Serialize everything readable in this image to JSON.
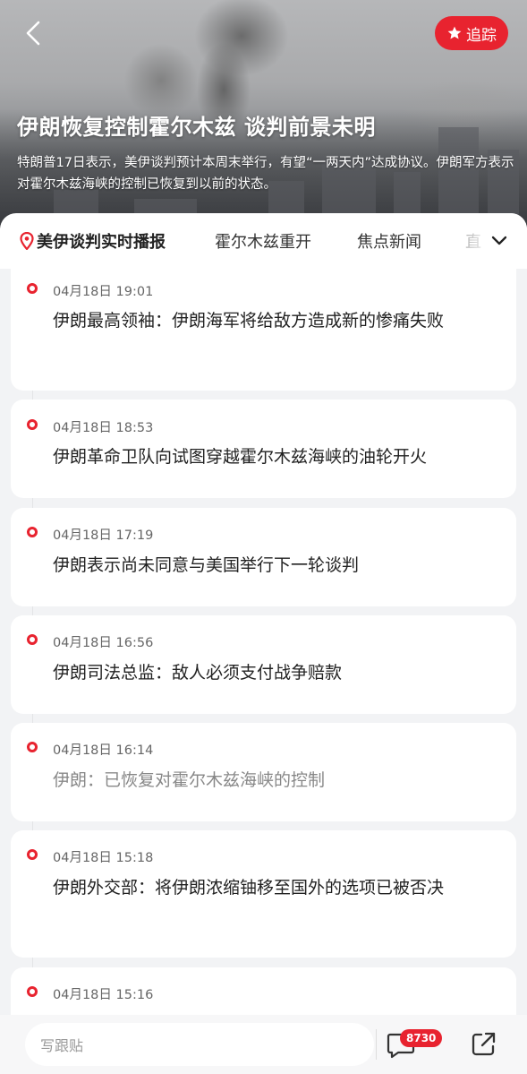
{
  "header": {
    "follow_label": "追踪",
    "title": "伊朗恢复控制霍尔木兹 谈判前景未明",
    "description": "特朗普17日表示，美伊谈判预计本周末举行，有望“一两天内”达成协议。伊朗军方表示对霍尔木兹海峡的控制已恢复到以前的状态。"
  },
  "tabs": [
    {
      "label": "美伊谈判实时播报",
      "active": true
    },
    {
      "label": "霍尔木兹重开",
      "active": false
    },
    {
      "label": "焦点新闻",
      "active": false
    },
    {
      "label": "直",
      "active": false
    }
  ],
  "feed": [
    {
      "time": "04月18日 19:01",
      "text": "伊朗最高领袖：伊朗海军将给敌方造成新的惨痛失败",
      "read": false
    },
    {
      "time": "04月18日 18:53",
      "text": "伊朗革命卫队向试图穿越霍尔木兹海峡的油轮开火",
      "read": false
    },
    {
      "time": "04月18日 17:19",
      "text": "伊朗表示尚未同意与美国举行下一轮谈判",
      "read": false
    },
    {
      "time": "04月18日 16:56",
      "text": "伊朗司法总监：敌人必须支付战争赔款",
      "read": false
    },
    {
      "time": "04月18日 16:14",
      "text": "伊朗：已恢复对霍尔木兹海峡的控制",
      "read": true
    },
    {
      "time": "04月18日 15:18",
      "text": "伊朗外交部：将伊朗浓缩铀移至国外的选项已被否决",
      "read": false
    },
    {
      "time": "04月18日 15:16",
      "text": "",
      "read": false
    }
  ],
  "bottom": {
    "comment_placeholder": "写跟贴",
    "comment_count": "8730"
  },
  "colors": {
    "accent": "#e8232f",
    "card_bg": "#ffffff",
    "page_bg": "#f2f3f5"
  },
  "icons": [
    "back-icon",
    "star-icon",
    "location-pin-icon",
    "chevron-down-icon",
    "comment-icon",
    "share-icon"
  ]
}
